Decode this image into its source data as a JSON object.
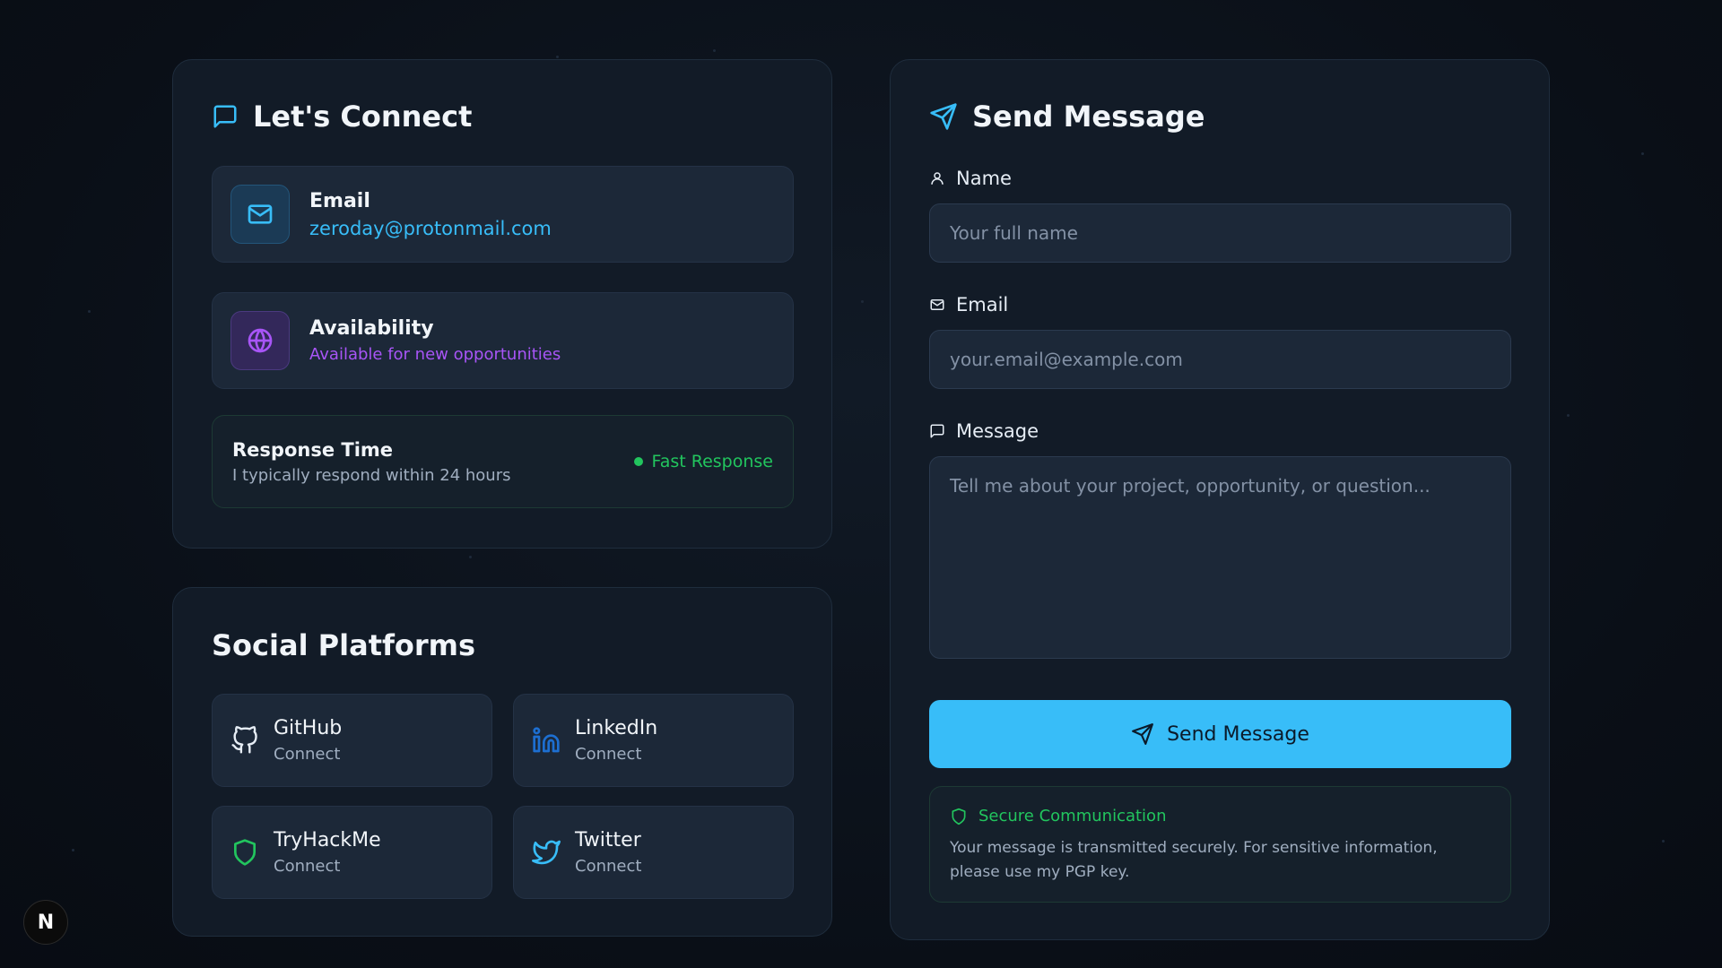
{
  "connect": {
    "title": "Let's Connect",
    "email": {
      "label": "Email",
      "value": "zeroday@protonmail.com"
    },
    "availability": {
      "label": "Availability",
      "value": "Available for new opportunities"
    },
    "response": {
      "title": "Response Time",
      "subtitle": "I typically respond within 24 hours",
      "badge": "Fast Response"
    }
  },
  "social": {
    "title": "Social Platforms",
    "items": [
      {
        "name": "GitHub",
        "action": "Connect",
        "icon": "github-icon"
      },
      {
        "name": "LinkedIn",
        "action": "Connect",
        "icon": "linkedin-icon"
      },
      {
        "name": "TryHackMe",
        "action": "Connect",
        "icon": "shield-icon"
      },
      {
        "name": "Twitter",
        "action": "Connect",
        "icon": "twitter-icon"
      }
    ]
  },
  "form": {
    "title": "Send Message",
    "name_label": "Name",
    "name_placeholder": "Your full name",
    "email_label": "Email",
    "email_placeholder": "your.email@example.com",
    "message_label": "Message",
    "message_placeholder": "Tell me about your project, opportunity, or question...",
    "submit_label": "Send Message",
    "secure_title": "Secure Communication",
    "secure_body": "Your message is transmitted securely. For sensitive information, please use my PGP key."
  },
  "dev_badge": "N",
  "colors": {
    "accent": "#38bdf8",
    "purple": "#a855f7",
    "green": "#22c55e",
    "card": "#121b27"
  }
}
